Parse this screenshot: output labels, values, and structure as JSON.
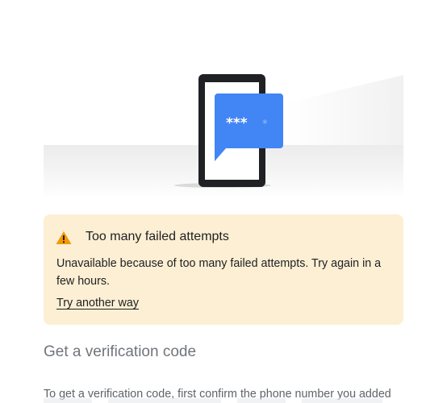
{
  "illustration": {
    "icon": "phone-with-password-bubble-illustration",
    "bubble_text": "***",
    "colors": {
      "bubble": "#4285f4",
      "phone_frame": "#202124"
    }
  },
  "alert": {
    "icon": "warning-triangle-icon",
    "title": "Too many failed attempts",
    "message": "Unavailable because of too many failed attempts. Try again in a few hours.",
    "link_label": "Try another way",
    "colors": {
      "background": "#fdefd3",
      "icon": "#f29900"
    }
  },
  "verification": {
    "heading": "Get a verification code",
    "body": "To get a verification code, first confirm the phone number you added"
  }
}
